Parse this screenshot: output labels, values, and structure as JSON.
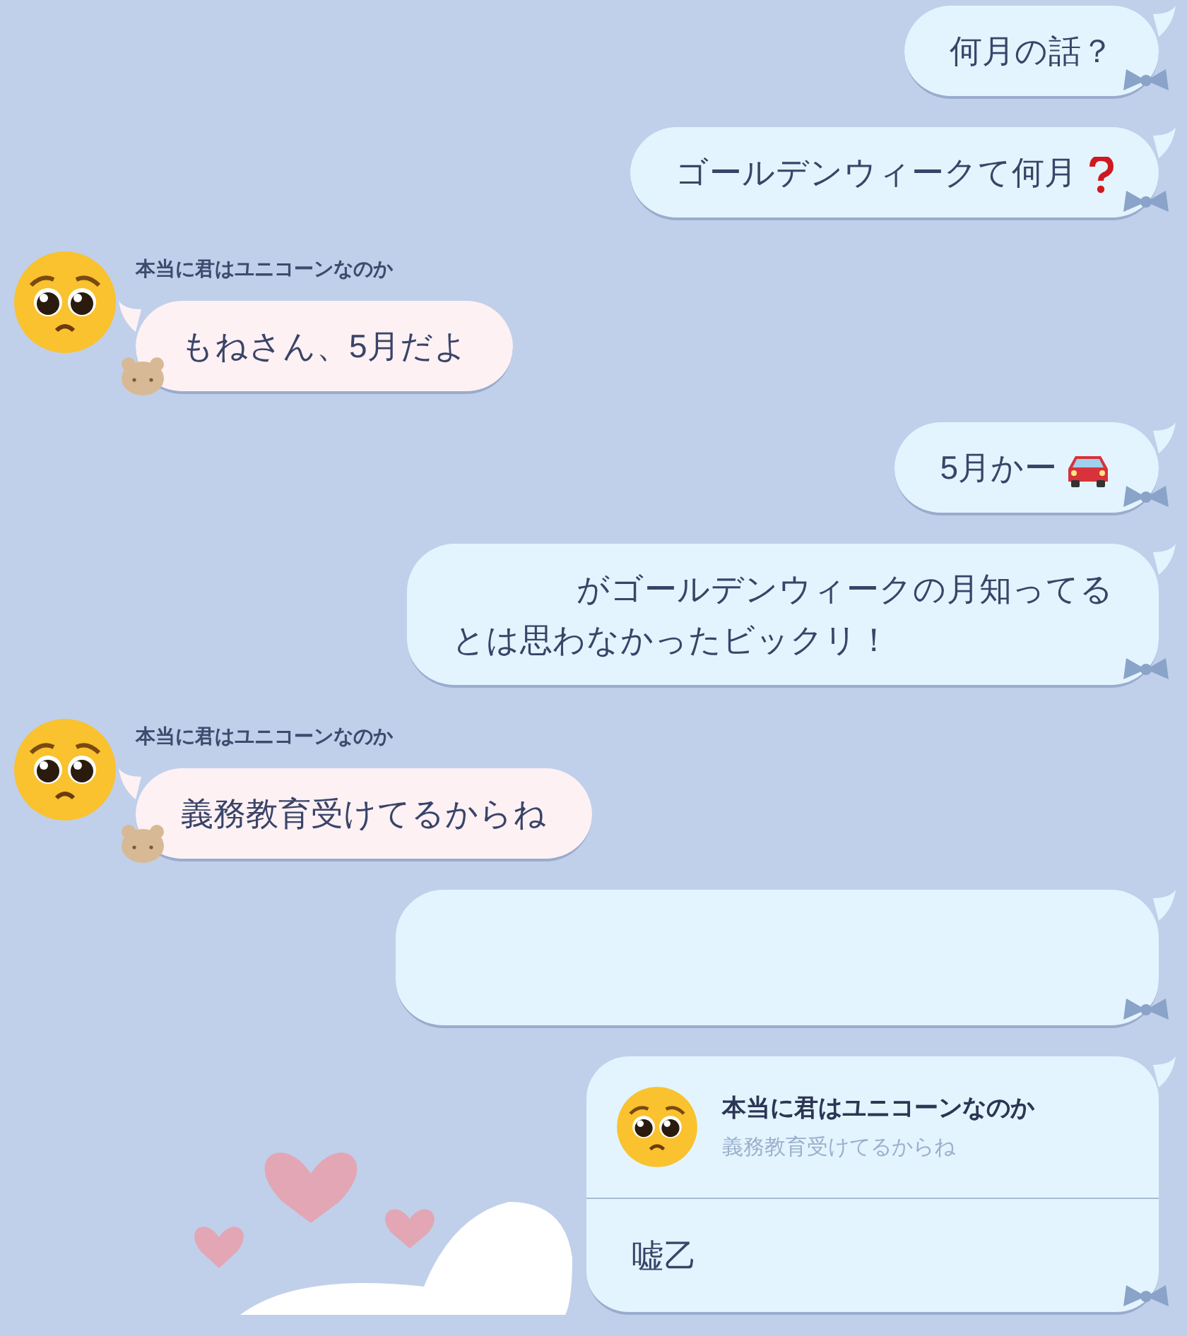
{
  "messages": [
    {
      "kind": "sent",
      "lines": [
        "何月の話？"
      ]
    },
    {
      "kind": "sent",
      "lines": [
        "ゴールデンウィークて何月"
      ],
      "inline_icon": {
        "kind": "question"
      }
    },
    {
      "kind": "received",
      "sender": "本当に君はユニコーンなのか",
      "lines": [
        "もねさん、5月だよ"
      ]
    },
    {
      "kind": "sent",
      "lines": [
        "5月かー"
      ],
      "inline_icon": {
        "kind": "car"
      }
    },
    {
      "kind": "sent",
      "lines": [
        "がゴールデンウィークの月知ってる",
        "とは思わなかったビックリ！"
      ],
      "indent_first": true
    },
    {
      "kind": "received",
      "sender": "本当に君はユニコーンなのか",
      "lines": [
        "義務教育受けてるからね"
      ]
    },
    {
      "kind": "sent"
    },
    {
      "kind": "reply",
      "quote_sender": "本当に君はユニコーンなのか",
      "quote_text": "義務教育受けてるからね",
      "lines": [
        "嘘乙"
      ]
    }
  ]
}
